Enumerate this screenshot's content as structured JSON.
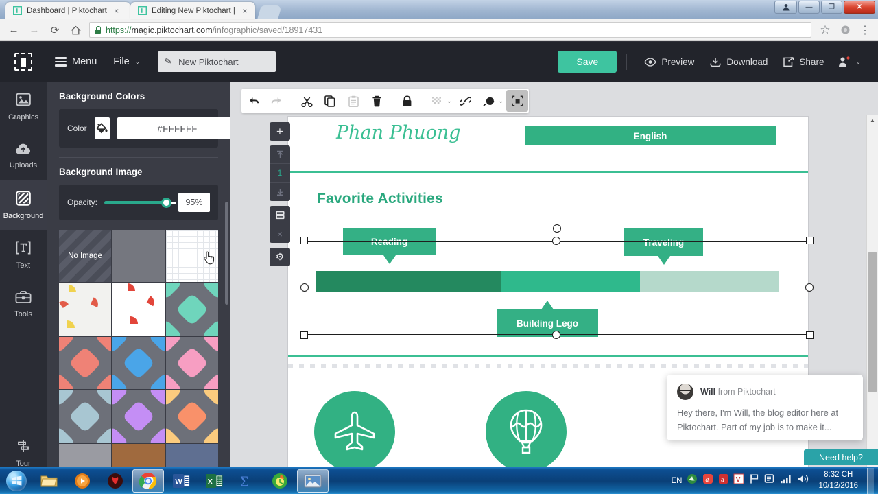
{
  "browser": {
    "tabs": [
      {
        "label": "Dashboard | Piktochart",
        "close": "×",
        "favicon": "piktochart-icon"
      },
      {
        "label": "Editing New Piktochart |",
        "close": "×",
        "favicon": "piktochart-icon"
      }
    ],
    "nav": {
      "back": "←",
      "forward": "→",
      "reload": "⟳",
      "home": "⌂"
    },
    "url_scheme": "https://",
    "url_host": "magic.piktochart.com",
    "url_path": "/infographic/saved/18917431",
    "bookmark_star": "☆",
    "extension": "extension-icon",
    "menu": "⋮",
    "window_buttons": {
      "user": "□",
      "minimize": "—",
      "maximize": "❐",
      "close": "✕"
    }
  },
  "app_header": {
    "logo": "piktochart-logo",
    "menu_label": "Menu",
    "file_label": "File",
    "file_caret": "⌄",
    "title_value": "New Piktochart",
    "save_label": "Save",
    "preview_label": "Preview",
    "download_label": "Download",
    "share_label": "Share",
    "account_caret": "⌄",
    "accent_green": "#3ec4a0"
  },
  "rail": {
    "items": [
      {
        "label": "Graphics",
        "icon": "image-icon",
        "active": false
      },
      {
        "label": "Uploads",
        "icon": "cloud-upload-icon",
        "active": false
      },
      {
        "label": "Background",
        "icon": "hatch-square-icon",
        "active": true
      },
      {
        "label": "Text",
        "icon": "text-box-icon",
        "active": false
      },
      {
        "label": "Tools",
        "icon": "toolbox-icon",
        "active": false
      }
    ],
    "bottom_item": {
      "label": "Tour",
      "icon": "tour-icon"
    }
  },
  "panel": {
    "bg_colors_heading": "Background Colors",
    "color_label": "Color",
    "color_swatch_icon": "paint-bucket-icon",
    "hex_value": "#FFFFFF",
    "bg_image_heading": "Background Image",
    "opacity_label": "Opacity:",
    "opacity_value": "95%",
    "opacity_percent": 95,
    "no_image_label": "No Image",
    "swatches": [
      {
        "name": "no-image",
        "kind": "noimg"
      },
      {
        "name": "solid-gray",
        "kind": "solid",
        "color": "#75777f"
      },
      {
        "name": "white-grid",
        "kind": "grid"
      },
      {
        "name": "melon-pattern-light",
        "kind": "melon",
        "color": "#f2f2ef"
      },
      {
        "name": "watermelon-pattern",
        "kind": "melon",
        "color": "#ffffff"
      },
      {
        "name": "diamond-teal",
        "kind": "diamond",
        "color": "#6fd5bc"
      },
      {
        "name": "diamond-salmon",
        "kind": "diamond",
        "color": "#ef8276"
      },
      {
        "name": "diamond-blue",
        "kind": "diamond",
        "color": "#4aa5e8"
      },
      {
        "name": "diamond-pink",
        "kind": "diamond",
        "color": "#f79ec2"
      },
      {
        "name": "diamond-steel-blue",
        "kind": "diamond",
        "color": "#a8c6d2"
      },
      {
        "name": "diamond-purple",
        "kind": "diamond",
        "color": "#c48ef5"
      },
      {
        "name": "diamond-orange",
        "kind": "diamond",
        "color": "#f9916a"
      },
      {
        "name": "solid-light-gray",
        "kind": "solid",
        "color": "#9a9ba2"
      },
      {
        "name": "solid-brown",
        "kind": "solid",
        "color": "#a06a3e"
      },
      {
        "name": "solid-slate",
        "kind": "solid",
        "color": "#5f6f91"
      }
    ]
  },
  "edit_toolbar": {
    "buttons": [
      {
        "name": "undo-button",
        "icon": "↶",
        "state": "enabled"
      },
      {
        "name": "redo-button",
        "icon": "↷",
        "state": "disabled"
      },
      {
        "name": "cut-button",
        "icon": "✂",
        "state": "enabled"
      },
      {
        "name": "copy-button",
        "icon": "⧉",
        "state": "enabled"
      },
      {
        "name": "paste-button",
        "icon": "Ὄb",
        "state": "disabled"
      },
      {
        "name": "delete-button",
        "icon": "Ὕ1",
        "state": "enabled"
      },
      {
        "name": "lock-button",
        "icon": "ὑ2",
        "state": "enabled"
      },
      {
        "name": "transparency-button",
        "icon": "checkerboard",
        "state": "disabled",
        "caret": "⌄"
      },
      {
        "name": "link-button",
        "icon": "ὑ7",
        "state": "enabled"
      },
      {
        "name": "color-button",
        "icon": "droplet",
        "state": "enabled",
        "caret": "⌄"
      },
      {
        "name": "arrange-button",
        "icon": "arrange",
        "state": "selected"
      }
    ]
  },
  "page_strip": {
    "add": "+",
    "move_up": "⤒",
    "page_number": "1",
    "move_down": "⤓",
    "duplicate": "☰",
    "remove": "×",
    "settings": "⚙"
  },
  "canvas": {
    "name_script": "Phan Phuong",
    "english_bar": "English",
    "section_title": "Favorite Activities",
    "tags": [
      {
        "label": "Reading",
        "direction": "down"
      },
      {
        "label": "Traveling",
        "direction": "down"
      },
      {
        "label": "Building Lego",
        "direction": "up"
      }
    ],
    "progress_segments": [
      {
        "name": "reading-segment",
        "color": "#24895f",
        "percent": 40
      },
      {
        "name": "traveling-segment",
        "color": "#2fb98c",
        "percent": 30
      },
      {
        "name": "building-lego-segment",
        "color": "#b5d9cb",
        "percent": 30
      }
    ],
    "icons": [
      {
        "name": "airplane-icon",
        "glyph": "airplane"
      },
      {
        "name": "hot-air-balloon-icon",
        "glyph": "balloon"
      }
    ],
    "green_primary": "#32b183",
    "green_rule": "#3bbf93",
    "scrollbar_up": "▲",
    "scrollbar_down": "▼"
  },
  "chat": {
    "sender_name": "Will",
    "sender_suffix": " from Piktochart",
    "message": "Hey there, I'm Will, the blog editor here at Piktochart. Part of my job is to make it...",
    "need_help_label": "Need help?",
    "need_help_color": "#2aa3a8"
  },
  "taskbar": {
    "start": "windows-orb",
    "apps": [
      {
        "name": "file-explorer-icon",
        "active": false
      },
      {
        "name": "media-player-icon",
        "active": false
      },
      {
        "name": "unikey-icon",
        "active": false
      },
      {
        "name": "chrome-icon",
        "active": true
      },
      {
        "name": "word-icon",
        "active": false
      },
      {
        "name": "excel-icon",
        "active": false
      },
      {
        "name": "mathtype-icon",
        "active": false
      },
      {
        "name": "zalo-icon",
        "active": false
      },
      {
        "name": "photo-viewer-icon",
        "active": true
      }
    ],
    "tray_language": "EN",
    "tray_icons": [
      "volume-icon",
      "network-icon",
      "action-center-icon",
      "flag-icon",
      "unikey-tray-icon",
      "avira-icon",
      "app-tray-icon"
    ],
    "clock_time": "8:32 CH",
    "clock_date": "10/12/2016"
  }
}
